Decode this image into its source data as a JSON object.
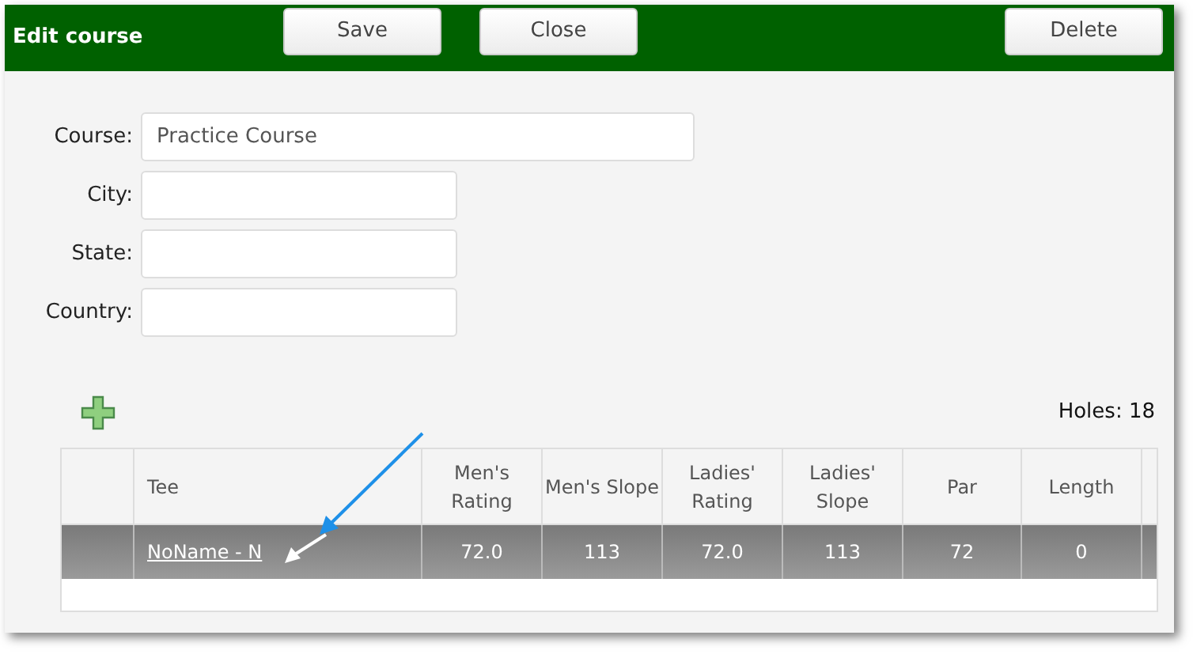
{
  "header": {
    "title": "Edit course",
    "buttons": [
      "Save",
      "Close"
    ],
    "delete_button": "Delete"
  },
  "form": {
    "fields": [
      {
        "label": "Course:",
        "value": "Practice Course",
        "kind": "long"
      },
      {
        "label": "City:",
        "kind": "short"
      },
      {
        "label": "State:",
        "kind": "short"
      },
      {
        "label": "Country:",
        "kind": "short"
      }
    ]
  },
  "holes": "Holes: 18",
  "table": {
    "columns": [
      "Tee",
      "Men's Rating",
      "Men's Slope",
      "Ladies' Rating",
      "Ladies' Slope",
      "Par",
      "Length"
    ],
    "rows": [
      {
        "selected": true,
        "cells": [
          "NoName - N",
          "72.0",
          "113",
          "72.0",
          "113",
          "72",
          "0"
        ]
      }
    ]
  }
}
